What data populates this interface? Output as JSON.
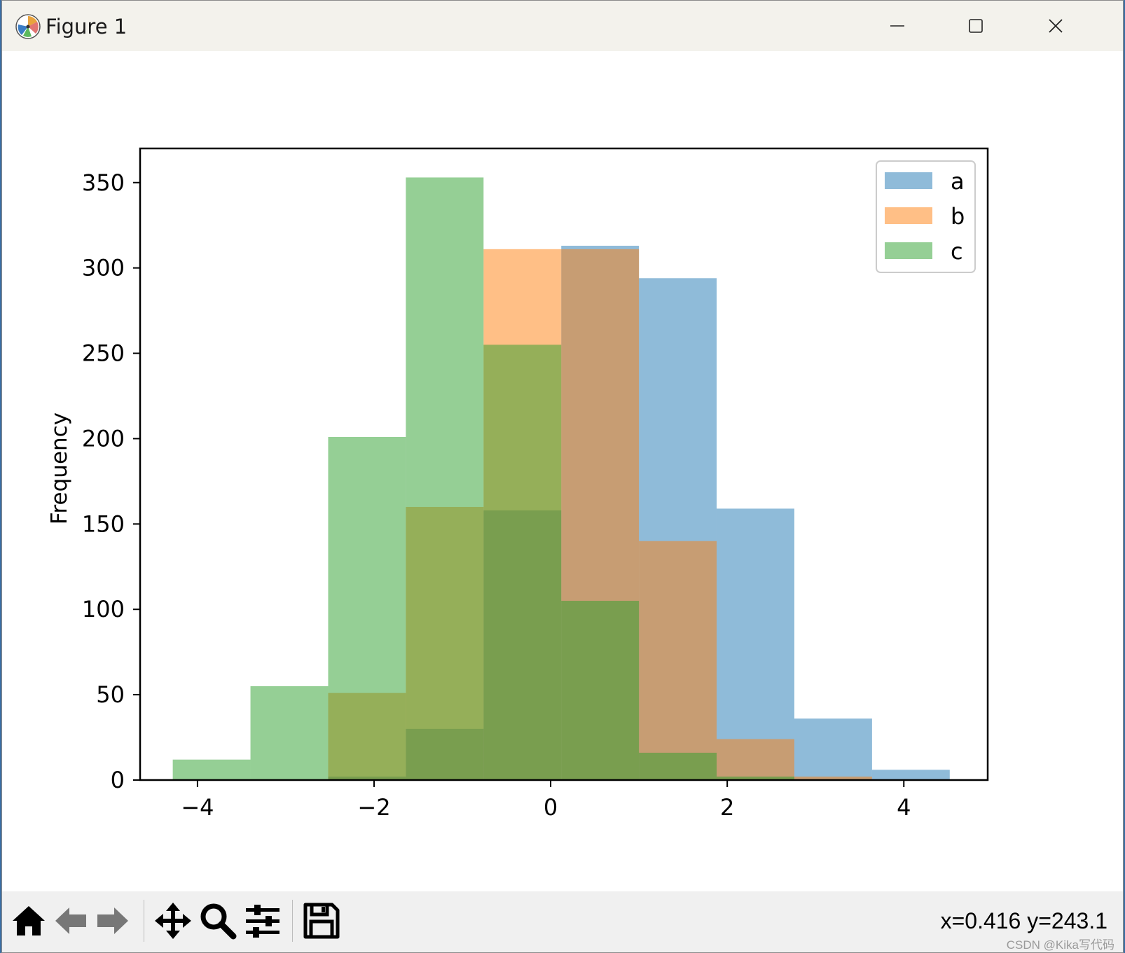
{
  "window": {
    "title": "Figure 1",
    "app_icon": "matplotlib-icon",
    "controls": [
      "minimize-icon",
      "maximize-icon",
      "close-icon"
    ]
  },
  "chart_data": {
    "type": "bar",
    "title": "",
    "xlabel": "",
    "ylabel": "Frequency",
    "xlim": [
      -4.65,
      4.95
    ],
    "ylim": [
      0,
      370
    ],
    "xticks": [
      -4,
      -2,
      0,
      2,
      4
    ],
    "xtick_labels": [
      "−4",
      "−2",
      "0",
      "2",
      "4"
    ],
    "yticks": [
      0,
      50,
      100,
      150,
      200,
      250,
      300,
      350
    ],
    "ytick_labels": [
      "0",
      "50",
      "100",
      "150",
      "200",
      "250",
      "300",
      "350"
    ],
    "bin_edges": [
      -4.28,
      -3.4,
      -2.52,
      -1.64,
      -0.76,
      0.12,
      1.0,
      1.88,
      2.76,
      3.64,
      4.52
    ],
    "series": [
      {
        "name": "a",
        "color": "#1f77b4",
        "alpha": 0.5,
        "values": [
          0,
          0,
          2,
          30,
          158,
          313,
          294,
          159,
          36,
          6
        ]
      },
      {
        "name": "b",
        "color": "#ff7f0e",
        "alpha": 0.5,
        "values": [
          0,
          0,
          51,
          160,
          311,
          311,
          140,
          24,
          2,
          0
        ]
      },
      {
        "name": "c",
        "color": "#2ca02c",
        "alpha": 0.5,
        "values": [
          12,
          55,
          201,
          353,
          255,
          105,
          16,
          2,
          0,
          0
        ]
      }
    ],
    "legend": {
      "entries": [
        "a",
        "b",
        "c"
      ],
      "placement": "top-right"
    },
    "grid": false
  },
  "toolbar": {
    "buttons": [
      {
        "name": "home-button",
        "icon": "home-icon"
      },
      {
        "name": "back-button",
        "icon": "back-arrow-icon"
      },
      {
        "name": "forward-button",
        "icon": "forward-arrow-icon"
      },
      {
        "name": "pan-button",
        "icon": "move-icon"
      },
      {
        "name": "zoom-button",
        "icon": "zoom-icon"
      },
      {
        "name": "configure-subplots-button",
        "icon": "sliders-icon"
      },
      {
        "name": "save-button",
        "icon": "save-icon"
      }
    ],
    "coordinates": "x=0.416 y=243.1",
    "watermark": "CSDN @Kika写代码"
  }
}
